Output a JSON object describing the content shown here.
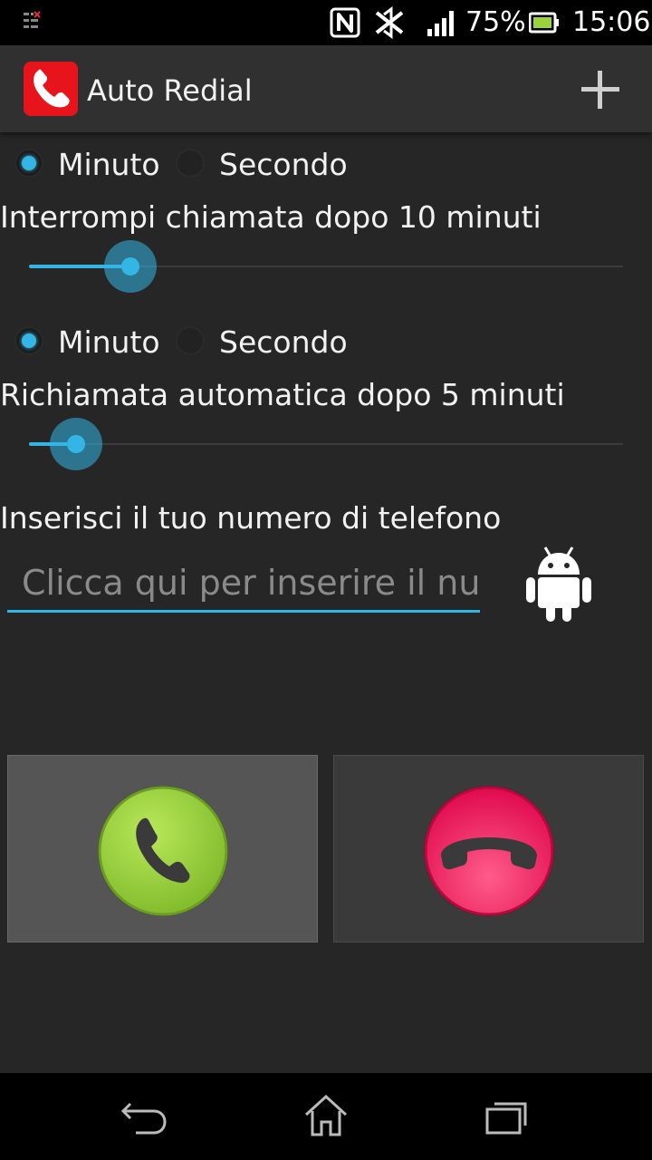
{
  "status_bar": {
    "battery_percent": "75%",
    "time": "15:06",
    "icons": [
      "notification-icon",
      "nfc-icon",
      "bluetooth-icon",
      "signal-icon",
      "battery-icon"
    ]
  },
  "action_bar": {
    "title": "Auto Redial",
    "icons": [
      "app-phone-icon",
      "add-icon"
    ]
  },
  "hangup_section": {
    "radio_minute": "Minuto",
    "radio_second": "Secondo",
    "selected": "Minuto",
    "heading": "Interrompi chiamata dopo 10 minuti",
    "slider_fraction": 0.17
  },
  "redial_section": {
    "radio_minute": "Minuto",
    "radio_second": "Secondo",
    "selected": "Minuto",
    "heading": "Richiamata automatica dopo 5 minuti",
    "slider_fraction": 0.08
  },
  "phone": {
    "label": "Inserisci il tuo numero di telefono",
    "placeholder": "Clicca qui per inserire il numero",
    "contact_icon": "android-icon"
  },
  "buttons": {
    "call_icon": "call-icon",
    "hangup_icon": "hangup-icon"
  },
  "nav_bar": {
    "icons": [
      "back-icon",
      "home-icon",
      "recents-icon"
    ]
  },
  "colors": {
    "accent": "#33b5e5",
    "call": "#9bd33a",
    "hangup": "#f0125a",
    "app_icon": "#e8141c"
  }
}
